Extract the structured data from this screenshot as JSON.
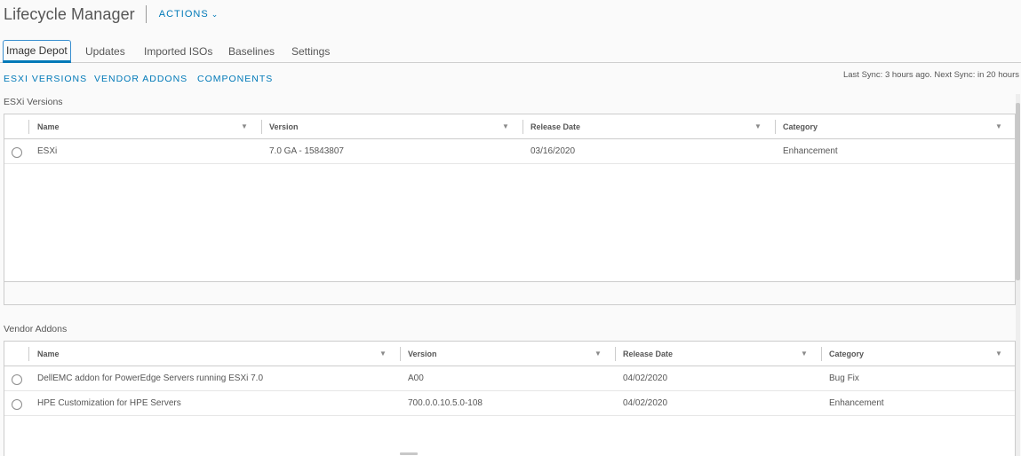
{
  "header": {
    "title": "Lifecycle Manager",
    "actions_label": "ACTIONS",
    "actions_chevron": "⌄"
  },
  "tabs": [
    {
      "label": "Image Depot",
      "active": true
    },
    {
      "label": "Updates"
    },
    {
      "label": "Imported ISOs"
    },
    {
      "label": "Baselines"
    },
    {
      "label": "Settings"
    }
  ],
  "subnav": {
    "esxi": "ESXI VERSIONS",
    "vendor": "VENDOR ADDONS",
    "components": "COMPONENTS"
  },
  "sync_status": "Last Sync: 3 hours ago. Next Sync: in 20 hours",
  "filter_glyph": "▼",
  "esxi_section": {
    "title": "ESXi Versions",
    "columns": [
      "Name",
      "Version",
      "Release Date",
      "Category"
    ],
    "rows": [
      {
        "name": "ESXi",
        "version": "7.0 GA - 15843807",
        "date": "03/16/2020",
        "category": "Enhancement"
      }
    ]
  },
  "vendor_section": {
    "title": "Vendor Addons",
    "columns": [
      "Name",
      "Version",
      "Release Date",
      "Category"
    ],
    "rows": [
      {
        "name": "DellEMC addon for PowerEdge Servers running ESXi 7.0",
        "version": "A00",
        "date": "04/02/2020",
        "category": "Bug Fix"
      },
      {
        "name": "HPE Customization for HPE Servers",
        "version": "700.0.0.10.5.0-108",
        "date": "04/02/2020",
        "category": "Enhancement"
      }
    ]
  }
}
